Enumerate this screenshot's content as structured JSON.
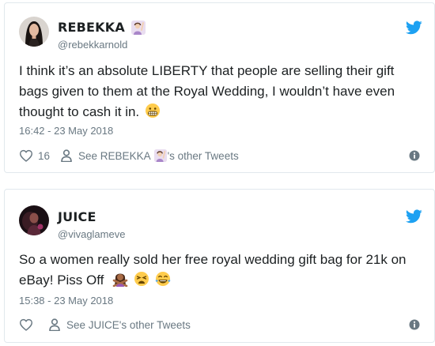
{
  "tweets": [
    {
      "display_name": "REBEKKA",
      "handle": "@rebekkarnold",
      "text": "I think it’s an absolute LIBERTY that people are selling their gift bags given to them at the Royal Wedding, I wouldn’t have even thought to cash it in.",
      "text_emojis": [
        "grimacing-face-emoji"
      ],
      "name_emoji": "woman-raising-hand-emoji",
      "timestamp": "16:42 - 23 May 2018",
      "like_count": "16",
      "see_other_prefix": "See REBEKKA",
      "see_other_suffix": "'s other Tweets"
    },
    {
      "display_name": "JUICE",
      "handle": "@vivaglameve",
      "text": "So a women really sold her free royal wedding gift bag for 21k on eBay! Piss Off",
      "text_emojis": [
        "woman-gesturing-no-emoji",
        "weary-face-emoji",
        "face-with-tears-of-joy-emoji"
      ],
      "timestamp": "15:38 - 23 May 2018",
      "like_count": "",
      "see_other": "See JUICE's other Tweets"
    }
  ],
  "colors": {
    "twitter_blue": "#1da1f2",
    "text": "#1c2022",
    "muted": "#697882",
    "border": "#e1e8ed"
  },
  "icons": [
    "twitter-bird-icon",
    "heart-icon",
    "person-icon",
    "info-icon"
  ]
}
